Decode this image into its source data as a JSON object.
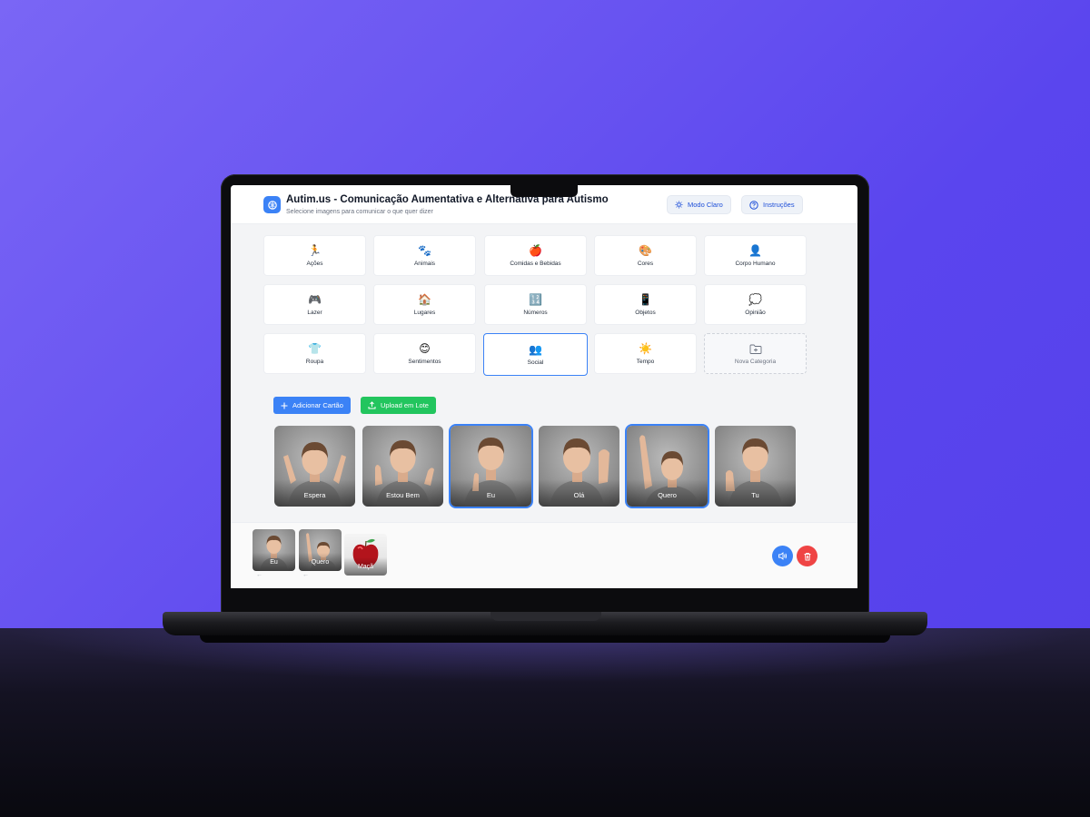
{
  "app": {
    "title": "Autim.us - Comunicação Aumentativa e Alternativa para Autismo",
    "subtitle": "Selecione imagens para comunicar o que quer dizer",
    "light_mode_label": "Modo Claro",
    "instructions_label": "Instruções"
  },
  "categories": [
    {
      "label": "Ações",
      "icon": "🏃"
    },
    {
      "label": "Animais",
      "icon": "🐾"
    },
    {
      "label": "Comidas e Bebidas",
      "icon": "🍎"
    },
    {
      "label": "Cores",
      "icon": "🎨"
    },
    {
      "label": "Corpo Humano",
      "icon": "👤"
    },
    {
      "label": "Lazer",
      "icon": "🎮"
    },
    {
      "label": "Lugares",
      "icon": "🏠"
    },
    {
      "label": "Números",
      "icon": "🔢"
    },
    {
      "label": "Objetos",
      "icon": "📱"
    },
    {
      "label": "Opinião",
      "icon": "💭"
    },
    {
      "label": "Roupa",
      "icon": "👕"
    },
    {
      "label": "Sentimentos",
      "icon": "😊"
    },
    {
      "label": "Social",
      "icon": "👥"
    },
    {
      "label": "Tempo",
      "icon": "☀️"
    },
    {
      "label": "Nova Categoria",
      "icon": "folder-plus-icon"
    }
  ],
  "selected_category": "Social",
  "actions": {
    "add_card_label": "Adicionar Cartão",
    "batch_upload_label": "Upload em Lote"
  },
  "cards": [
    {
      "label": "Espera",
      "selected": false
    },
    {
      "label": "Estou Bem",
      "selected": false
    },
    {
      "label": "Eu",
      "selected": true
    },
    {
      "label": "Olá",
      "selected": false
    },
    {
      "label": "Quero",
      "selected": true
    },
    {
      "label": "Tu",
      "selected": false
    }
  ],
  "sentence": [
    {
      "label": "Eu"
    },
    {
      "label": "Quero"
    },
    {
      "label": "Maçã"
    }
  ],
  "colors": {
    "accent": "#3b82f6",
    "upload_green": "#22c55e",
    "delete_red": "#ef4444",
    "background": "#5a45ee"
  }
}
